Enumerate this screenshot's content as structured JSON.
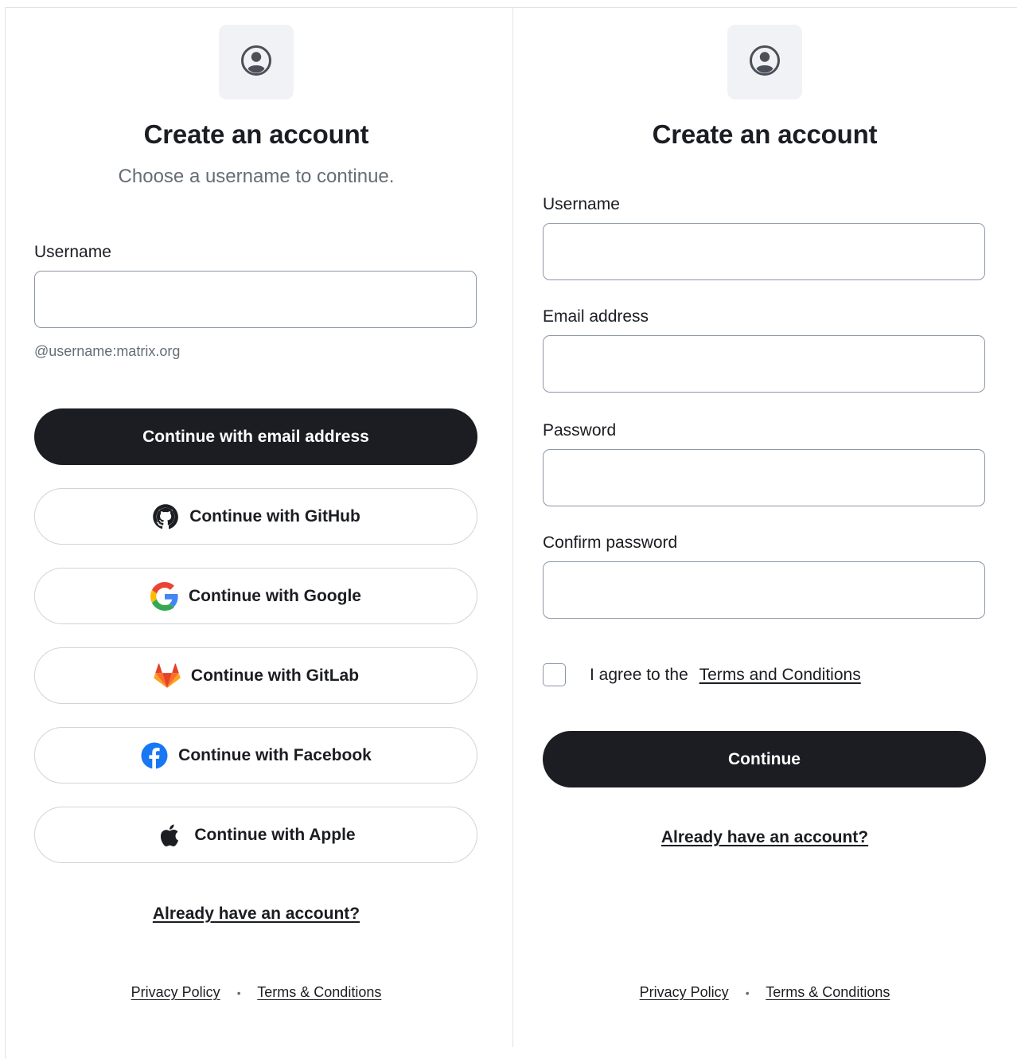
{
  "left_panel": {
    "title": "Create an account",
    "subtitle": "Choose a username to continue.",
    "username_label": "Username",
    "username_value": "",
    "username_hint": "@username:matrix.org",
    "continue_email_label": "Continue with email address",
    "sso_buttons": {
      "github": "Continue with GitHub",
      "google": "Continue with Google",
      "gitlab": "Continue with GitLab",
      "facebook": "Continue with Facebook",
      "apple": "Continue with Apple"
    },
    "signin_link": "Already have an account?",
    "footer": {
      "privacy": "Privacy Policy",
      "separator": "•",
      "terms": "Terms & Conditions"
    }
  },
  "right_panel": {
    "title": "Create an account",
    "username_label": "Username",
    "username_value": "",
    "email_label": "Email address",
    "email_value": "",
    "password_label": "Password",
    "password_value": "",
    "confirm_label": "Confirm password",
    "confirm_value": "",
    "agree_prefix": "I agree to the",
    "agree_link": "Terms and Conditions",
    "agree_checked": false,
    "continue_label": "Continue",
    "signin_link": "Already have an account?",
    "footer": {
      "privacy": "Privacy Policy",
      "separator": "•",
      "terms": "Terms & Conditions"
    }
  },
  "icons": {
    "avatar": "user-circle-icon",
    "github": "github-icon",
    "google": "google-icon",
    "gitlab": "gitlab-icon",
    "facebook": "facebook-icon",
    "apple": "apple-icon"
  },
  "colors": {
    "primary_button": "#1b1d22",
    "text": "#1b1d22",
    "muted_text": "#656d77",
    "input_border": "#8d97a5",
    "outline_button_border": "#cfd4db",
    "avatar_tile": "#f0f2f5",
    "facebook_blue": "#1877f2"
  }
}
